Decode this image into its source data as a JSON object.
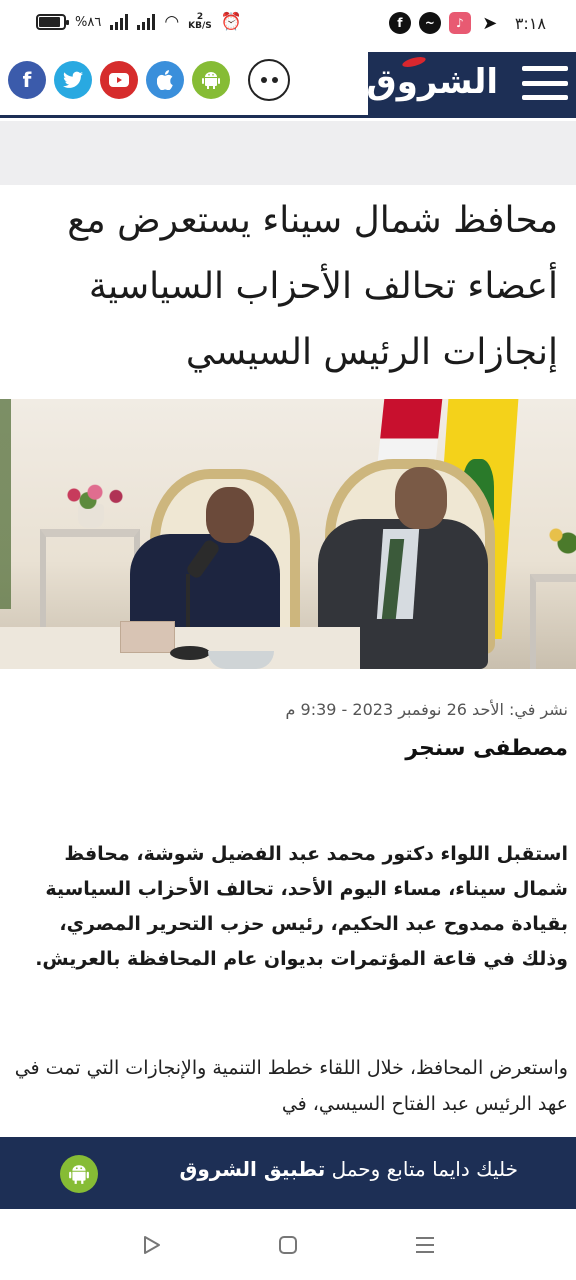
{
  "status_bar": {
    "time": "٣:١٨",
    "battery_text": "%٨٦",
    "battery_level": 0.86,
    "speed_value": "2",
    "speed_unit": "KB/S",
    "notification_icons": [
      "facebook-icon",
      "messenger-icon",
      "music-app-icon",
      "telegram-icon"
    ]
  },
  "header": {
    "logo_text": "الشروق",
    "social_icons": [
      "facebook",
      "twitter",
      "youtube",
      "apple",
      "android"
    ],
    "colors": {
      "brand_navy": "#1d2f55",
      "facebook": "#3b5bab",
      "twitter": "#29a9e1",
      "youtube": "#d62c2c",
      "apple": "#3a8fdb",
      "android": "#86bc35"
    }
  },
  "article": {
    "title": "محافظ شمال سيناء يستعرض مع أعضاء تحالف الأحزاب السياسية إنجازات الرئيس السيسي",
    "published": "نشر في: الأحد 26 نوفمبر 2023 - 9:39 م",
    "author": "مصطفى سنجر",
    "lead": "استقبل اللواء دكتور محمد عبد الفضيل شوشة، محافظ شمال سيناء، مساء اليوم الأحد، تحالف الأحزاب السياسية بقيادة ممدوح عبد الحكيم، رئيس حزب التحرير المصري، وذلك في قاعة المؤتمرات بديوان عام المحافظة بالعريش.",
    "body": "واستعرض المحافظ، خلال اللقاء خطط التنمية والإنجازات التي تمت في عهد الرئيس عبد الفتاح السيسي، في"
  },
  "app_banner": {
    "app_name": "تطبيق الشروق",
    "text": "خليك دايما متابع وحمل"
  },
  "nav": {
    "buttons": [
      "back",
      "home",
      "recents"
    ]
  }
}
